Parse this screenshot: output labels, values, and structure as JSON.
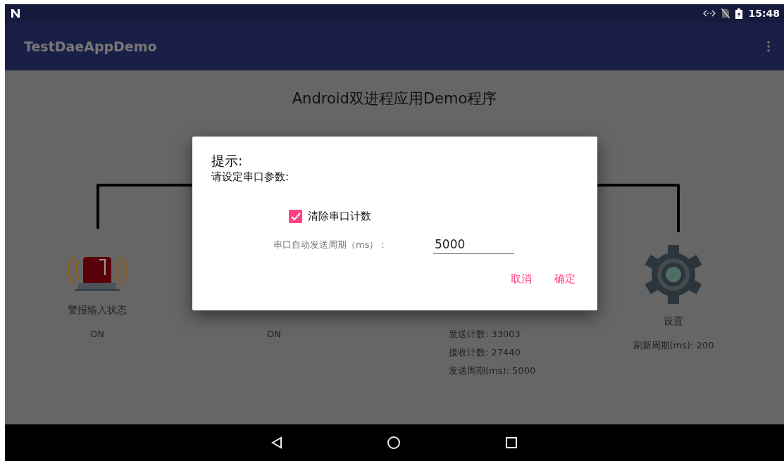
{
  "status_bar": {
    "time": "15:48"
  },
  "app_bar": {
    "title": "TestDaeAppDemo"
  },
  "content": {
    "title": "Android双进程应用Demo程序",
    "panels": [
      {
        "kind": "alarm",
        "label": "警报输入状态",
        "lines": [
          "ON"
        ]
      },
      {
        "kind": "hidden",
        "lines": [
          "ON"
        ]
      },
      {
        "kind": "hidden",
        "lines": [
          "发送计数: 33003",
          "接收计数: 27440",
          "发送周期(ms): 5000"
        ]
      },
      {
        "kind": "gear",
        "label": "设置",
        "lines": [
          "刷新周期(ms): 200"
        ]
      }
    ]
  },
  "dialog": {
    "title": "提示:",
    "message": "请设定串口参数:",
    "checkbox": {
      "label": "清除串口计数",
      "checked": true
    },
    "field": {
      "label": "串口自动发送周期（ms）：",
      "value": "5000"
    },
    "buttons": [
      "取消",
      "确定"
    ]
  }
}
